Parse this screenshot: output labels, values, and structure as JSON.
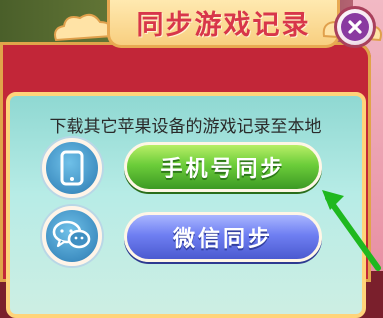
{
  "dialog": {
    "title": "同步游戏记录",
    "instruction": "下载其它苹果设备的游戏记录至本地"
  },
  "buttons": {
    "phone_sync": "手机号同步",
    "wechat_sync": "微信同步"
  },
  "icons": {
    "close": "close-icon",
    "phone": "phone-icon",
    "wechat": "wechat-icon",
    "arrow": "green-pointer-arrow"
  },
  "colors": {
    "frame": "#c22638",
    "title_text": "#d8364a",
    "green_button": "#6ccd3a",
    "blue_button": "#6f7ff2",
    "icon_circle": "#3f8fc2"
  }
}
